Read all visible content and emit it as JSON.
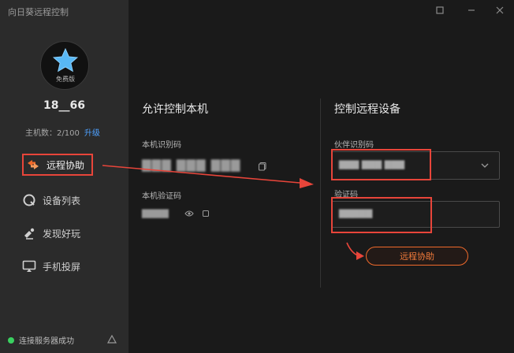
{
  "app": {
    "title": "向日葵远程控制"
  },
  "user": {
    "badge": "免费版",
    "name": "18__66",
    "device_count_label": "主机数：2/100",
    "upgrade_label": "升级"
  },
  "nav": [
    {
      "label": "远程协助"
    },
    {
      "label": "设备列表"
    },
    {
      "label": "发现好玩"
    },
    {
      "label": "手机投屏"
    }
  ],
  "status": {
    "text": "连接服务器成功"
  },
  "allow": {
    "title": "允许控制本机",
    "code_label": "本机识别码",
    "code_value": "▇▇▇ ▇▇▇ ▇▇▇",
    "verify_label": "本机验证码",
    "verify_value": "▇▇▇▇"
  },
  "remote": {
    "title": "控制远程设备",
    "partner_label": "伙伴识别码",
    "partner_value": "▇▇▇ ▇▇▇ ▇▇▇",
    "verify_label": "验证码",
    "verify_value": "▇▇▇▇▇",
    "connect_label": "远程协助"
  },
  "colors": {
    "accent": "#f06a2b",
    "highlight": "#e8453a",
    "link": "#4ea1ff",
    "online": "#3ad160"
  }
}
